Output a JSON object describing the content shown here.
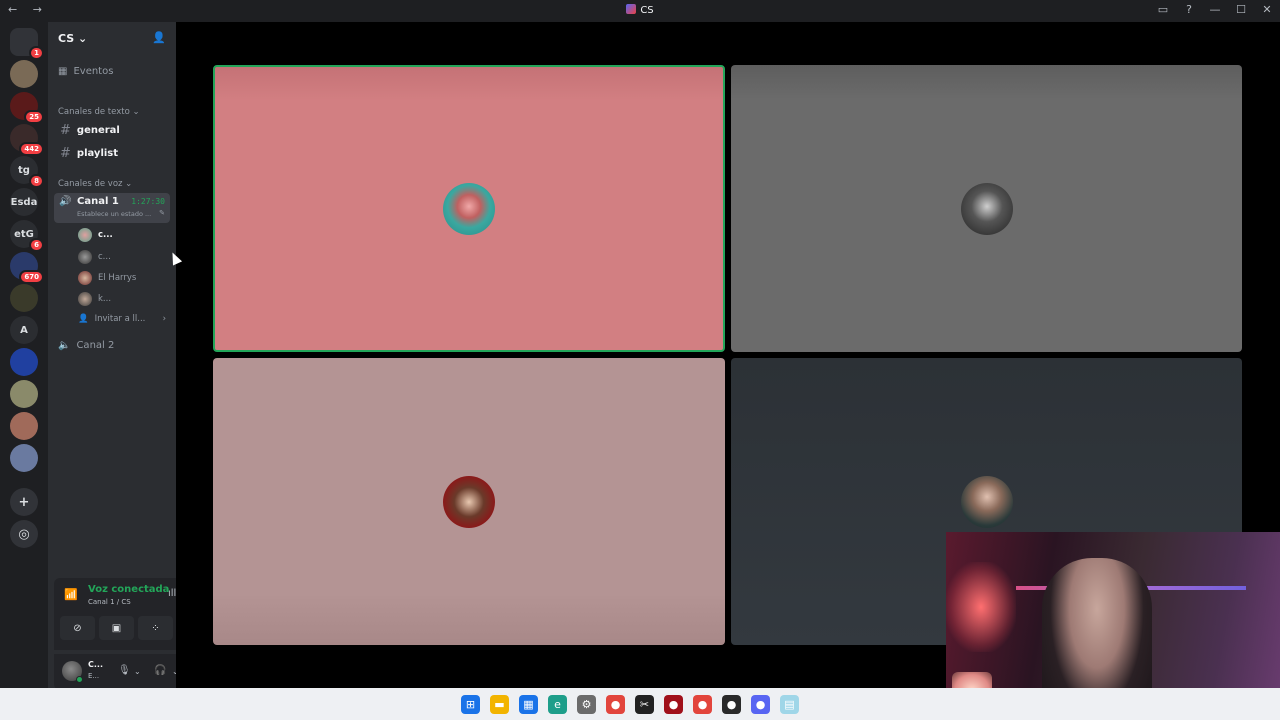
{
  "window": {
    "title": "CS",
    "nav": "← →",
    "controls": {
      "inbox": "▭",
      "help": "?",
      "minimize": "—",
      "maximize": "☐",
      "close": "✕"
    }
  },
  "guilds": [
    {
      "name": "discord-home",
      "label": "",
      "color": "#313338",
      "badge": "1"
    },
    {
      "name": "server-2",
      "label": "",
      "color": "#7a6a56",
      "badge": ""
    },
    {
      "name": "server-3",
      "label": "",
      "color": "#5a1a1a",
      "badge": "25"
    },
    {
      "name": "server-4",
      "label": "",
      "color": "#3a2a2a",
      "badge": "442"
    },
    {
      "name": "server-tg",
      "label": "tg",
      "color": "#2b2d31",
      "badge": "8"
    },
    {
      "name": "server-esda",
      "label": "Esda",
      "color": "#2b2d31",
      "badge": ""
    },
    {
      "name": "server-etg",
      "label": "etG",
      "color": "#2b2d31",
      "badge": "6"
    },
    {
      "name": "server-8",
      "label": "",
      "color": "#2a3a6a",
      "badge": "670"
    },
    {
      "name": "server-9",
      "label": "",
      "color": "#3a3a2a",
      "badge": ""
    },
    {
      "name": "server-a",
      "label": "A",
      "color": "#2b2d31",
      "badge": ""
    },
    {
      "name": "server-csgo",
      "label": "",
      "color": "#2040a0",
      "badge": ""
    },
    {
      "name": "server-12",
      "label": "",
      "color": "#8a8a6a",
      "badge": ""
    },
    {
      "name": "server-13",
      "label": "",
      "color": "#a06a5a",
      "badge": ""
    },
    {
      "name": "server-14",
      "label": "",
      "color": "#6a7aa0",
      "badge": ""
    }
  ],
  "sidebar": {
    "server_name": "CS",
    "events_label": "Eventos",
    "text_category": "Canales de texto",
    "text_channels": [
      "general",
      "playlist"
    ],
    "voice_category": "Canales de voz",
    "active_voice": {
      "name": "Canal 1",
      "timer": "1:27:30",
      "status": "Establece un estado ..."
    },
    "voice_users": [
      "c...",
      "c...",
      "El Harrys",
      "k..."
    ],
    "invite_label": "Invitar a ll...",
    "other_voice": "Canal 2"
  },
  "rtc": {
    "title": "Voz conectada",
    "subtitle": "Canal 1 / CS"
  },
  "user": {
    "name": "C...",
    "status": "E..."
  },
  "tiles": [
    {
      "name": "tile-speaking",
      "color": "#d27f82"
    },
    {
      "name": "tile-grey",
      "color": "#6b6b6b"
    },
    {
      "name": "tile-harrys",
      "color": "#b49494"
    },
    {
      "name": "tile-dark",
      "color": "#33393f"
    }
  ],
  "taskbar": [
    {
      "name": "windows-start-icon",
      "glyph": "⊞",
      "color": "#1a73e8"
    },
    {
      "name": "file-explorer-icon",
      "glyph": "▬",
      "color": "#f2b400"
    },
    {
      "name": "store-icon",
      "glyph": "▦",
      "color": "#1a73e8"
    },
    {
      "name": "edge-icon",
      "glyph": "e",
      "color": "#1e9e8a"
    },
    {
      "name": "settings-icon",
      "glyph": "⚙",
      "color": "#6b6b6b"
    },
    {
      "name": "chrome-icon",
      "glyph": "●",
      "color": "#e2453c"
    },
    {
      "name": "capcut-icon",
      "glyph": "✂",
      "color": "#222222"
    },
    {
      "name": "red-app-icon",
      "glyph": "●",
      "color": "#a0101a"
    },
    {
      "name": "chrome-2-icon",
      "glyph": "●",
      "color": "#e2453c"
    },
    {
      "name": "app-dark-icon",
      "glyph": "●",
      "color": "#2a2a2a"
    },
    {
      "name": "discord-taskbar-icon",
      "glyph": "●",
      "color": "#5865f2"
    },
    {
      "name": "notepad-icon",
      "glyph": "▤",
      "color": "#9fd6e8"
    }
  ]
}
